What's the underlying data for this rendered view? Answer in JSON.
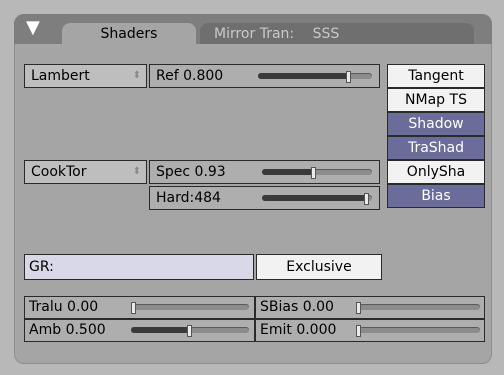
{
  "header": {
    "collapse_icon": "triangle-down-icon",
    "tabs": [
      {
        "label": "Shaders",
        "active": true
      },
      {
        "label": "Mirror Tran:",
        "active": false
      },
      {
        "label": "SSS",
        "active": false
      }
    ]
  },
  "diffuse": {
    "shader_menu": "Lambert",
    "ref": {
      "label": "Ref",
      "value": "0.800",
      "level": 0.8
    }
  },
  "specular": {
    "shader_menu": "CookTor",
    "spec": {
      "label": "Spec",
      "value": "0.93",
      "level": 0.47
    },
    "hard": {
      "label": "Hard:",
      "value": "484",
      "level": 0.95
    }
  },
  "toggles": [
    {
      "label": "Tangent",
      "on": true
    },
    {
      "label": "NMap TS",
      "on": true
    },
    {
      "label": "Shadow",
      "on": false
    },
    {
      "label": "TraShad",
      "on": false
    },
    {
      "label": "OnlySha",
      "on": true
    },
    {
      "label": "Bias",
      "on": false
    }
  ],
  "group": {
    "label": "GR:",
    "value": "",
    "exclusive_label": "Exclusive"
  },
  "bottom": {
    "tralu": {
      "label": "Tralu",
      "value": "0.00",
      "level": 0.0
    },
    "sbias": {
      "label": "SBias",
      "value": "0.00",
      "level": 0.0
    },
    "amb": {
      "label": "Amb",
      "value": "0.500",
      "level": 0.5
    },
    "emit": {
      "label": "Emit",
      "value": "0.000",
      "level": 0.0
    }
  },
  "colors": {
    "toggle_on": "#f2f2f2",
    "toggle_off": "#6a6d99",
    "panel": "#a5a5a5",
    "header": "#7e7e7e"
  }
}
